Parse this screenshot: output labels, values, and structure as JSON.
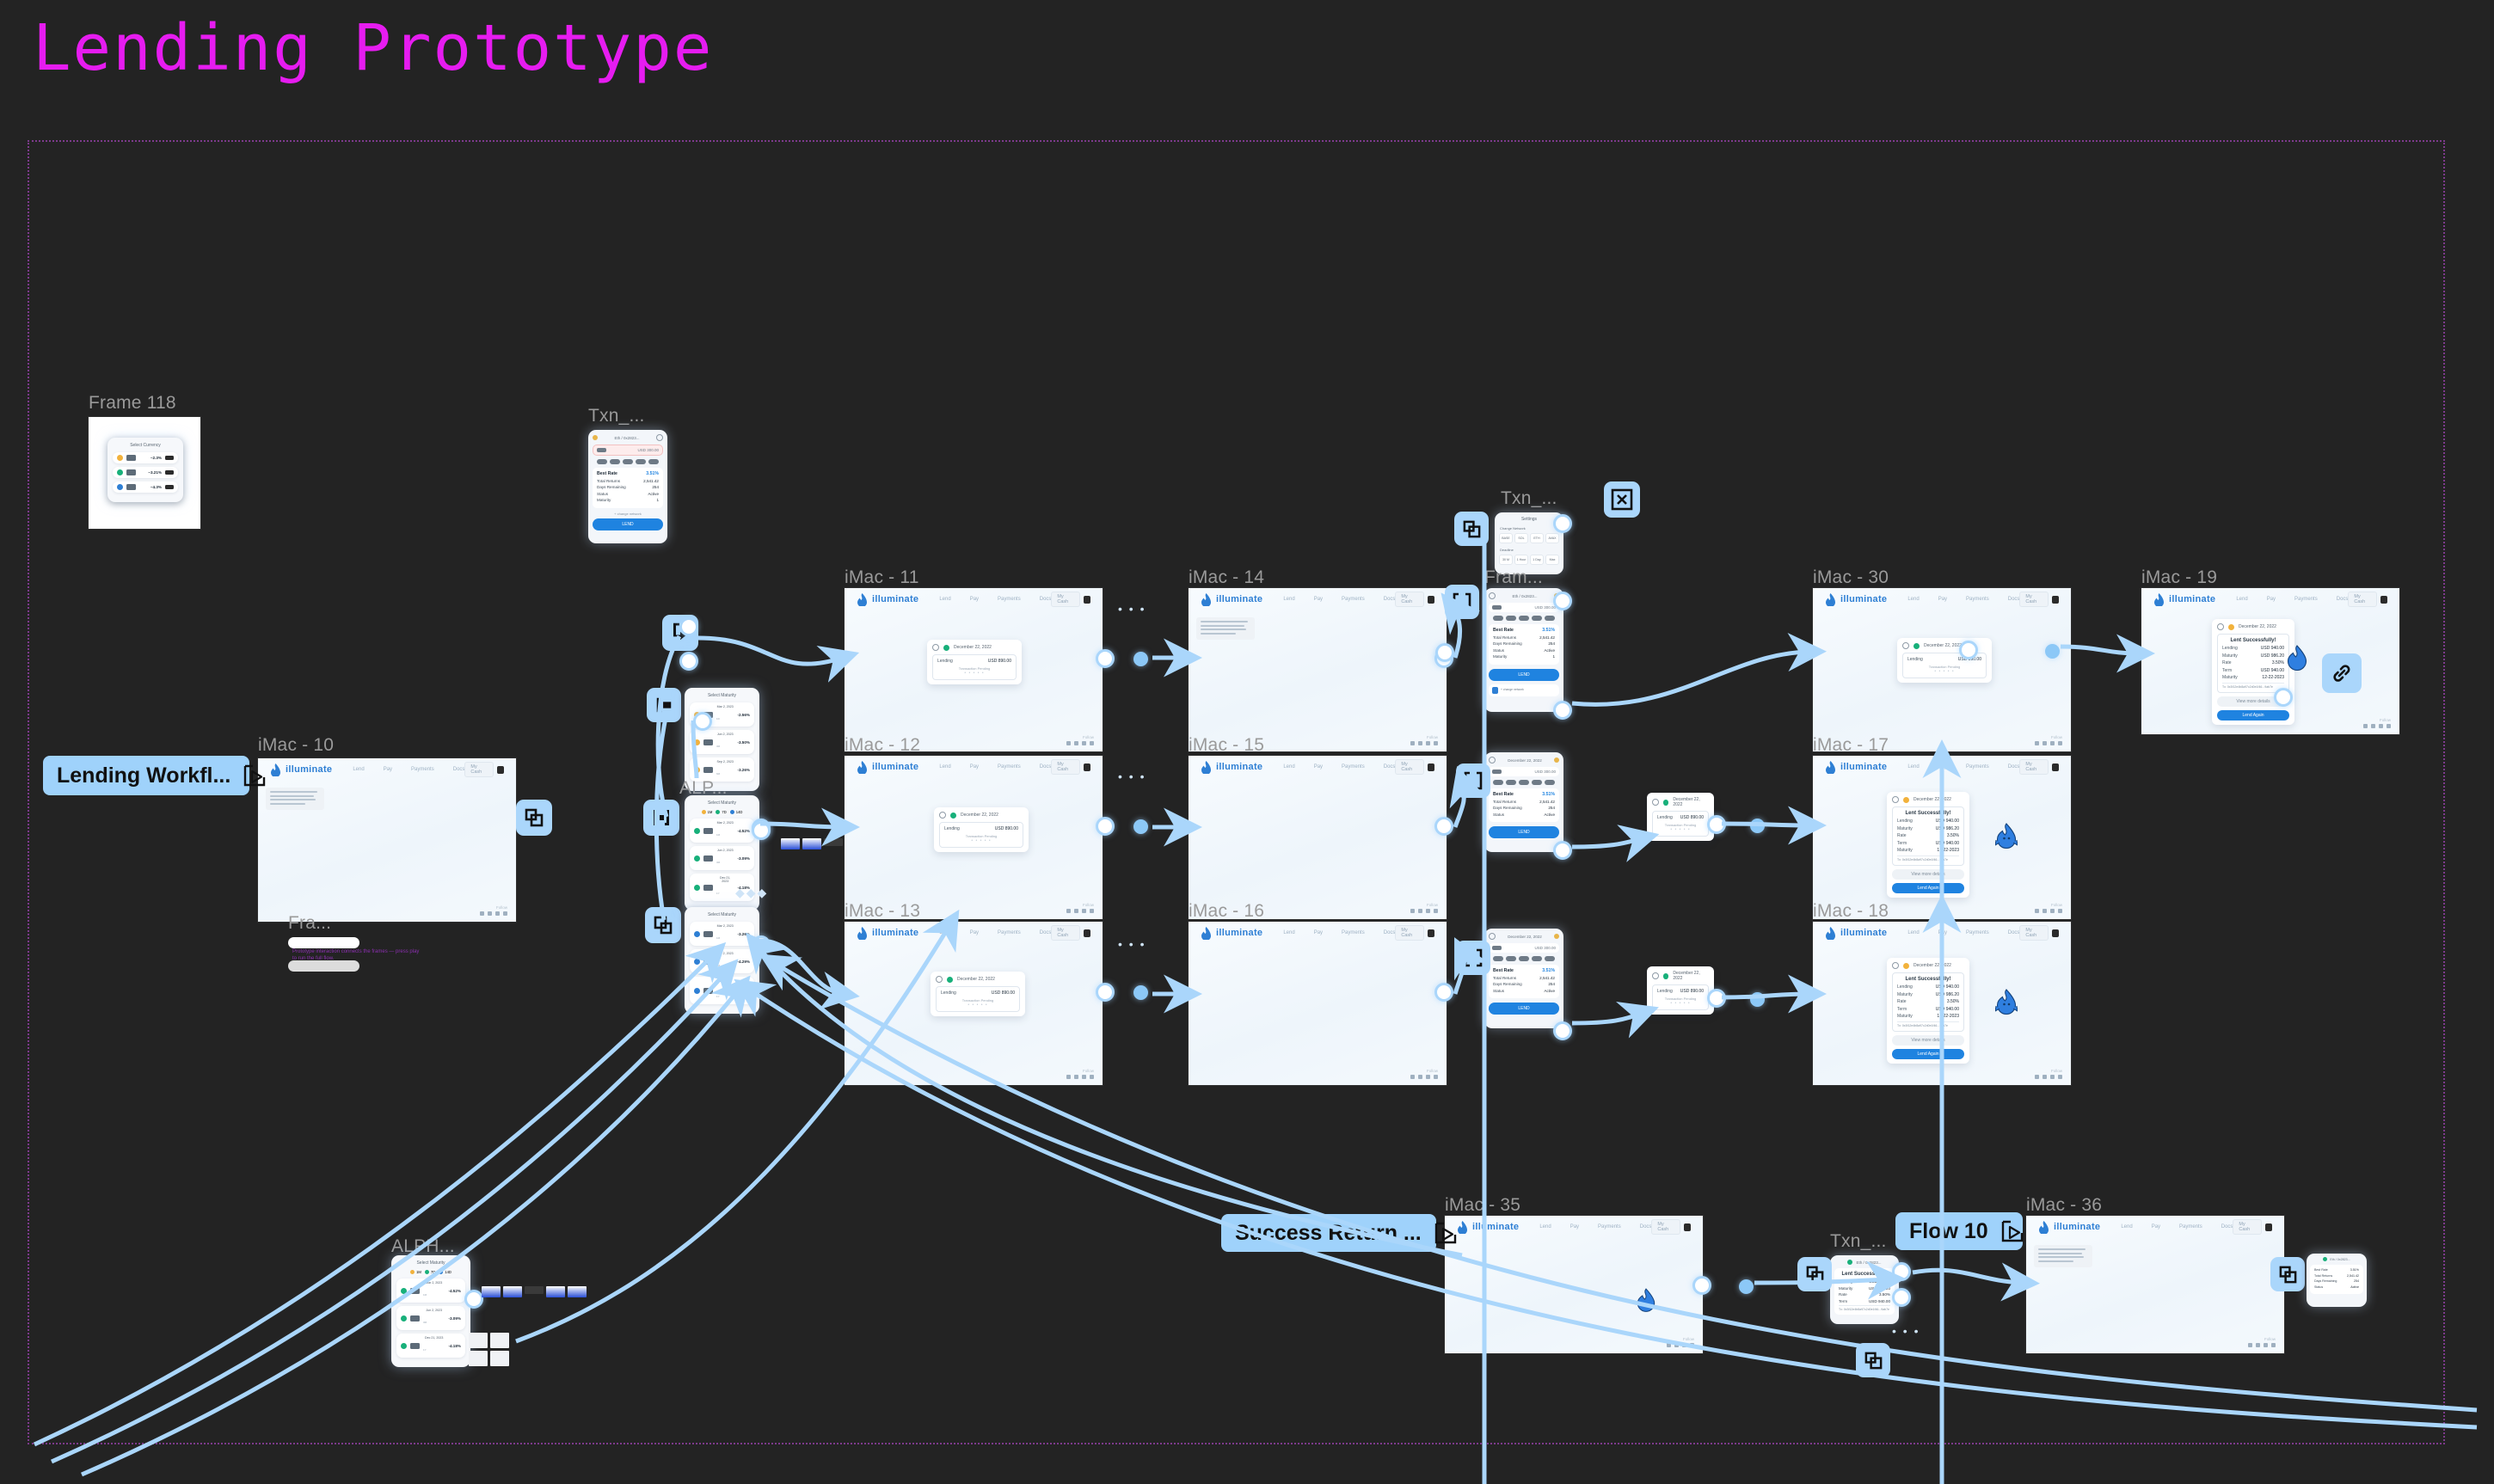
{
  "page": {
    "title": "Lending Prototype",
    "title_color": "#e61cf0",
    "canvas_bg": "#232323",
    "section_border_color": "#7d3a8c",
    "accent_blue": "#aad6fb",
    "brand_blue": "#2e7fd4",
    "cta_blue": "#1f83e0"
  },
  "brand": {
    "name": "illuminate",
    "logo_icon": "flame-icon"
  },
  "nav": {
    "links": [
      "Lend",
      "Pay",
      "Payments",
      "Docs"
    ],
    "account_label": "My Cash"
  },
  "frames": [
    {
      "id": "frame-118",
      "label": "Frame 118"
    },
    {
      "id": "txn-top",
      "label": "Txn_..."
    },
    {
      "id": "imac-10",
      "label": "iMac - 10"
    },
    {
      "id": "fra",
      "label": "Fra..."
    },
    {
      "id": "alpha-mid",
      "label": "ALP..."
    },
    {
      "id": "imac-11",
      "label": "iMac - 11"
    },
    {
      "id": "imac-12",
      "label": "iMac - 12"
    },
    {
      "id": "imac-13",
      "label": "iMac - 13"
    },
    {
      "id": "imac-14",
      "label": "iMac - 14"
    },
    {
      "id": "imac-15",
      "label": "iMac - 15"
    },
    {
      "id": "imac-16",
      "label": "iMac - 16"
    },
    {
      "id": "txn-mid",
      "label": "Txn_..."
    },
    {
      "id": "fram-mid",
      "label": "Fram..."
    },
    {
      "id": "imac-30",
      "label": "iMac - 30"
    },
    {
      "id": "imac-17",
      "label": "iMac - 17"
    },
    {
      "id": "imac-18",
      "label": "iMac - 18"
    },
    {
      "id": "imac-19",
      "label": "iMac - 19"
    },
    {
      "id": "alpha-bot",
      "label": "ALPH..."
    },
    {
      "id": "imac-35",
      "label": "iMac - 35"
    },
    {
      "id": "txn-bot",
      "label": "Txn_..."
    },
    {
      "id": "imac-36",
      "label": "iMac - 36"
    }
  ],
  "prototype_pills": [
    {
      "id": "lending-workflow",
      "label": "Lending Workfl...",
      "icon": "play-prototype-icon"
    },
    {
      "id": "success-return",
      "label": "Success Return ...",
      "icon": "play-prototype-icon"
    },
    {
      "id": "flow-10",
      "label": "Flow 10",
      "icon": "play-prototype-icon"
    }
  ],
  "badges": [
    {
      "id": "b1",
      "icon": "open-overlay-icon"
    },
    {
      "id": "b2",
      "icon": "swap-overlay-icon"
    },
    {
      "id": "b3",
      "icon": "scroll-to-icon"
    },
    {
      "id": "b4",
      "icon": "open-overlay-icon"
    },
    {
      "id": "b5",
      "icon": "component-instance-icon"
    },
    {
      "id": "b6",
      "icon": "close-overlay-icon"
    },
    {
      "id": "b7",
      "icon": "component-instance-icon"
    },
    {
      "id": "b8",
      "icon": "brackets-icon"
    },
    {
      "id": "b9",
      "icon": "component-instance-icon"
    },
    {
      "id": "b10",
      "icon": "component-instance-icon"
    },
    {
      "id": "b11",
      "icon": "component-instance-icon"
    },
    {
      "id": "b12",
      "icon": "link-icon"
    },
    {
      "id": "b13",
      "icon": "component-instance-icon"
    },
    {
      "id": "b14",
      "icon": "component-instance-icon"
    },
    {
      "id": "b15",
      "icon": "component-instance-icon"
    }
  ],
  "select_currency_card": {
    "title": "Select Currency",
    "rows": [
      {
        "code_dot": "#f2b23c",
        "rate": "~2.3%"
      },
      {
        "code_dot": "#18b07a",
        "rate": "~3.21%"
      },
      {
        "code_dot": "#2e7fd4",
        "rate": "~4.3%"
      }
    ]
  },
  "select_maturity_cards": [
    {
      "title": "Select Maturity",
      "tabs": [
        "1M",
        "7D",
        "14D"
      ],
      "rows": [
        {
          "name": "Mar 2, 2023",
          "sub": "1D",
          "pct": "-2.56%",
          "dot": "#f2b23c"
        },
        {
          "name": "Jun 2, 2023",
          "sub": "3M",
          "pct": "-3.50%",
          "dot": "#f2b23c"
        },
        {
          "name": "Sep 2, 2023",
          "sub": "6M",
          "pct": "-3.26%",
          "dot": "#f2b23c"
        }
      ]
    },
    {
      "title": "Select Maturity",
      "tabs": [
        "1M",
        "7D",
        "14D"
      ],
      "rows": [
        {
          "name": "Mar 2, 2023",
          "sub": "1M",
          "pct": "-4.52%",
          "dot": "#18b07a"
        },
        {
          "name": "Jun 2, 2023",
          "sub": "3M",
          "pct": "-3.09%",
          "dot": "#18b07a"
        },
        {
          "name": "Dec 21, 2023",
          "sub": "1Y",
          "pct": "-4.18%",
          "dot": "#18b07a"
        }
      ]
    },
    {
      "title": "Select Maturity",
      "tabs": [
        "1M",
        "7D",
        "14D"
      ],
      "rows": [
        {
          "name": "Mar 2, 2023",
          "sub": "1M",
          "pct": "-3.26%",
          "dot": "#2e7fd4"
        },
        {
          "name": "Jun 2, 2023",
          "sub": "3M",
          "pct": "-4.29%",
          "dot": "#2e7fd4"
        },
        {
          "name": "Dec 21, 2023",
          "sub": "1Y",
          "pct": "-4.96%",
          "dot": "#2e7fd4"
        }
      ]
    }
  ],
  "txn_phone": {
    "header_center": "Eth / 0x2823...",
    "amount_placeholder": "USD 300.00",
    "panel": [
      {
        "k": "Best Rate",
        "v": "3.51%"
      },
      {
        "k": "Total Returns",
        "v": "2,541.42"
      },
      {
        "k": "Days Remaining",
        "v": "254"
      },
      {
        "k": "Status",
        "v": "Active"
      },
      {
        "k": "Maturity",
        "v": "1"
      }
    ],
    "change_link": "+ change network",
    "cta": "LEND"
  },
  "settings_popup": {
    "title": "Settings",
    "group1_label": "Change Network",
    "group1_options": [
      "BASE",
      "SOL",
      "ETH",
      "AVAX"
    ],
    "group2_label": "Deadline",
    "group2_options": [
      "30 M",
      "1 Hour",
      "1 Day",
      "Max"
    ]
  },
  "lending_mini_card": {
    "date": "December 22, 2022",
    "row_key": "Lending",
    "row_value": "USD 890.00",
    "sub": "Transaction Pending",
    "dots": "• • • • •"
  },
  "success_card": {
    "title": "Lent Successfully!",
    "rows": [
      {
        "k": "Lending",
        "v": "USD 940.00"
      },
      {
        "k": "Maturity",
        "v": "USD 986.20"
      },
      {
        "k": "Rate",
        "v": "3.50%"
      },
      {
        "k": "Term",
        "v": "USD 940.00"
      },
      {
        "k": "Maturity",
        "v": "12-22-2023"
      }
    ],
    "hash_label": "Tx:",
    "hash": "0x3f12e4b8a97c2d0e1f46...9ab7e",
    "btn_ghost": "View more details",
    "btn_primary": "Lend Again"
  },
  "annotation_note": "Prototype interaction connects the frames — press play to run the full flow.",
  "mascot": {
    "name": "flame-mascot",
    "color": "#2f7fe0"
  }
}
